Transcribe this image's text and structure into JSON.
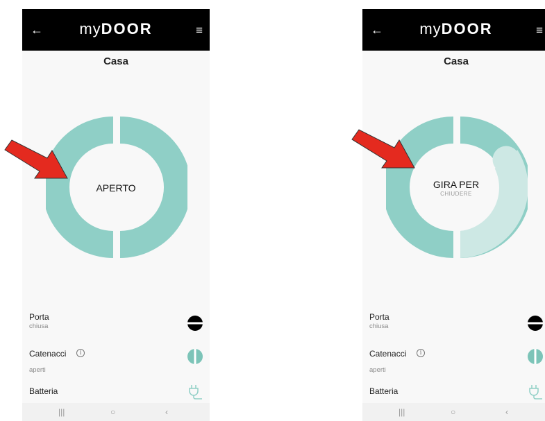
{
  "app": {
    "logo_prefix": "my",
    "logo_name": "DOOR"
  },
  "icons": {
    "back": "arrow-left-icon",
    "menu": "hamburger-menu-icon",
    "info": "info-icon",
    "plug": "plug-icon"
  },
  "colors": {
    "ring": "#8fcfc6",
    "ring_light": "#cde8e4",
    "header": "#000000",
    "arrow": "#e42a1f"
  },
  "glyphs": {
    "back": "←",
    "menu": "≡",
    "info": "i",
    "nav_recent": "|||",
    "nav_home": "○",
    "nav_back": "‹"
  },
  "screens": [
    {
      "title": "Casa",
      "status": "APERTO",
      "status_sub": "",
      "rows": {
        "porta_label": "Porta",
        "porta_value": "chiusa",
        "catenacci_label": "Catenacci",
        "catenacci_value": "aperti",
        "batteria_label": "Batteria"
      }
    },
    {
      "title": "Casa",
      "status": "GIRA PER",
      "status_sub": "CHIUDERE",
      "rows": {
        "porta_label": "Porta",
        "porta_value": "chiusa",
        "catenacci_label": "Catenacci",
        "catenacci_value": "aperti",
        "batteria_label": "Batteria"
      }
    }
  ]
}
